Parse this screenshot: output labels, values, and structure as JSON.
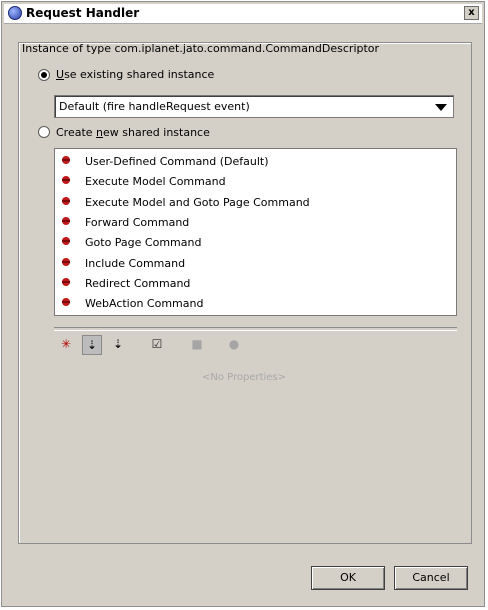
{
  "window": {
    "title": "Request Handler",
    "close_label": "x"
  },
  "instance_label": "Instance of type com.iplanet.jato.command.CommandDescriptor",
  "options": {
    "existing": {
      "prefix": "",
      "mnemonic": "U",
      "rest": "se existing shared instance",
      "selected": true
    },
    "create": {
      "prefix": "Create ",
      "mnemonic": "n",
      "rest": "ew shared instance",
      "selected": false
    }
  },
  "dropdown": {
    "value": "Default (fire handleRequest event)"
  },
  "commands": [
    {
      "label": "User-Defined Command (Default)",
      "icon": "command-icon"
    },
    {
      "label": "Execute Model Command",
      "icon": "command-icon"
    },
    {
      "label": "Execute Model and Goto Page Command",
      "icon": "command-icon"
    },
    {
      "label": "Forward Command",
      "icon": "command-icon"
    },
    {
      "label": "Goto Page Command",
      "icon": "command-icon"
    },
    {
      "label": "Include Command",
      "icon": "command-icon"
    },
    {
      "label": "Redirect Command",
      "icon": "command-icon"
    },
    {
      "label": "WebAction Command",
      "icon": "command-icon"
    }
  ],
  "toolbar": [
    {
      "name": "unsorted-icon",
      "glyph": "✳"
    },
    {
      "name": "sort-by-name-icon",
      "glyph": "⇣"
    },
    {
      "name": "sort-by-type-icon",
      "glyph": "⇣"
    },
    {
      "name": "editable-only-icon",
      "glyph": "☑"
    },
    {
      "name": "customize-icon",
      "glyph": "■"
    },
    {
      "name": "help-icon",
      "glyph": "●"
    }
  ],
  "properties_empty": "<No Properties>",
  "buttons": {
    "ok": "OK",
    "cancel": "Cancel"
  },
  "colors": {
    "accent_red": "#c0181a",
    "title_icon": "#2a3fa8"
  }
}
